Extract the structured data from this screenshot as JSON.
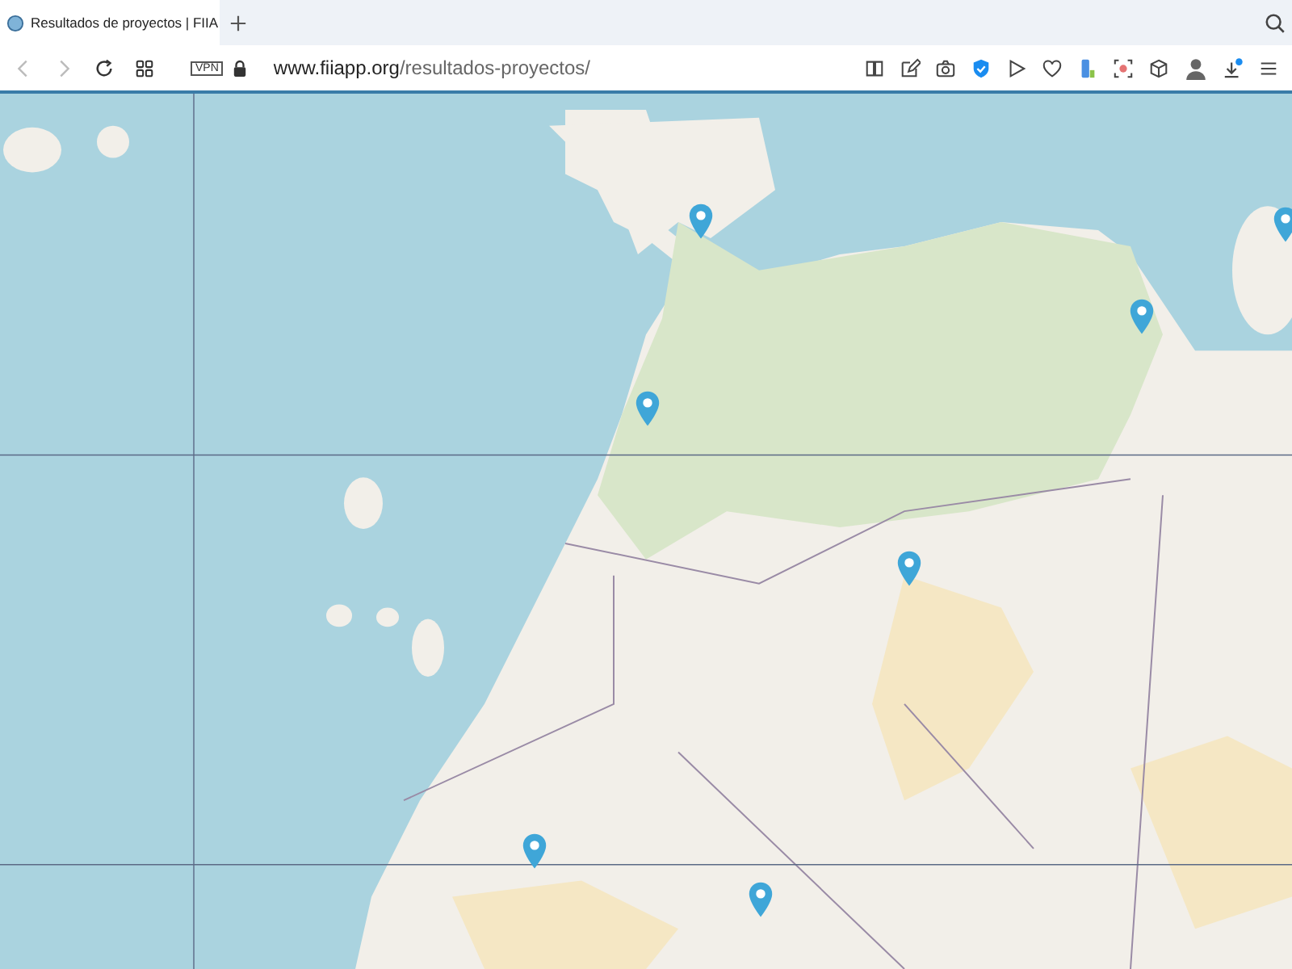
{
  "tab": {
    "title": "Resultados de proyectos | FIIA",
    "selected": true
  },
  "address": {
    "vpn": "VPN",
    "domain": "www.fiiapp.org",
    "path": "/resultados-proyectos/"
  },
  "downloads": {
    "notification": true
  }
}
